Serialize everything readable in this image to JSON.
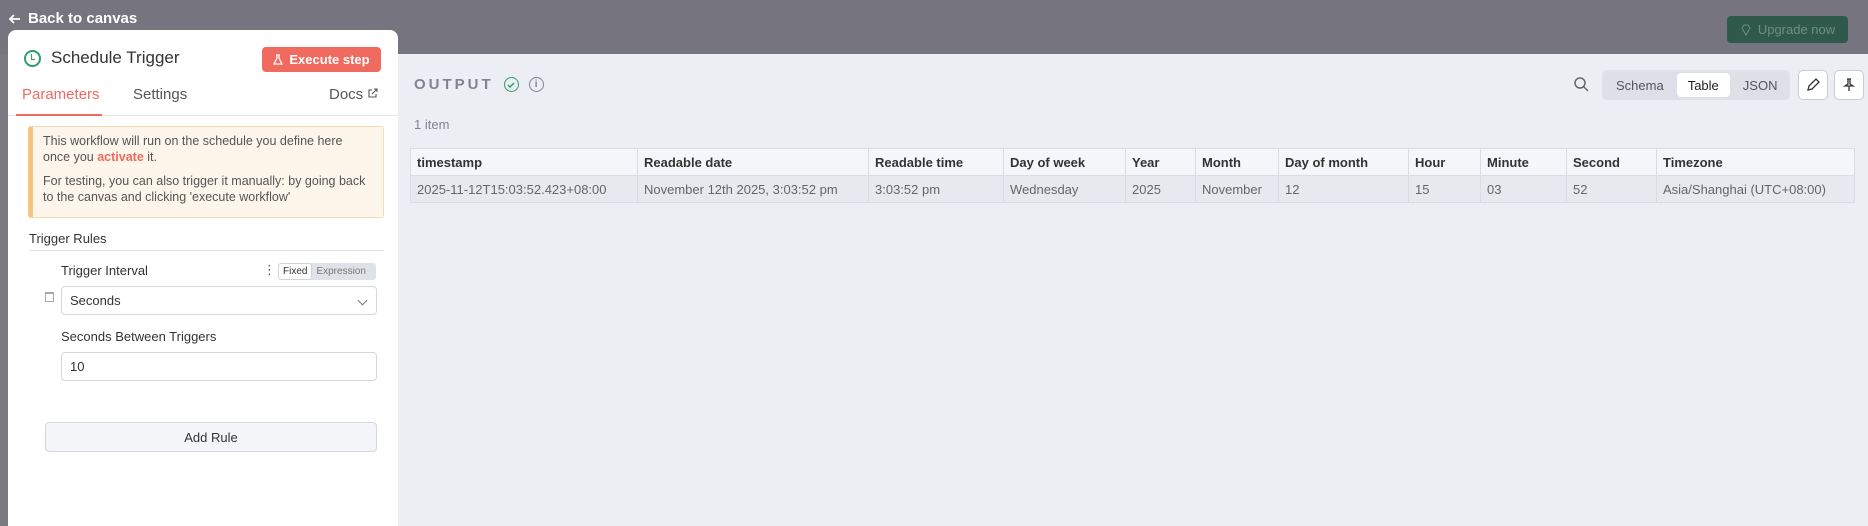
{
  "topbar": {
    "back_label": "Back to canvas",
    "upgrade_label": "Upgrade now"
  },
  "panel": {
    "title": "Schedule Trigger",
    "execute_label": "Execute step",
    "tabs": [
      "Parameters",
      "Settings"
    ],
    "docs_label": "Docs",
    "notice": {
      "line1": "This workflow will run on the schedule you define here once you",
      "activate_word": "activate",
      "line1_end": "it.",
      "line2": "For testing, you can also trigger it manually: by going back to the canvas and clicking 'execute workflow'"
    },
    "section_title": "Trigger Rules",
    "trigger_interval_label": "Trigger Interval",
    "mode_fixed": "Fixed",
    "mode_expression": "Expression",
    "interval_value": "Seconds",
    "seconds_label": "Seconds Between Triggers",
    "seconds_value": "10",
    "add_rule_label": "Add Rule"
  },
  "output": {
    "label": "OUTPUT",
    "views": [
      "Schema",
      "Table",
      "JSON"
    ],
    "active_view": "Table",
    "item_count": "1 item",
    "columns": [
      "timestamp",
      "Readable date",
      "Readable time",
      "Day of week",
      "Year",
      "Month",
      "Day of month",
      "Hour",
      "Minute",
      "Second",
      "Timezone"
    ],
    "rows": [
      [
        "2025-11-12T15:03:52.423+08:00",
        "November 12th 2025, 3:03:52 pm",
        "3:03:52 pm",
        "Wednesday",
        "2025",
        "November",
        "12",
        "15",
        "03",
        "52",
        "Asia/Shanghai (UTC+08:00)"
      ]
    ]
  },
  "colors": {
    "accent": "#f06a5f",
    "success": "#2e9e6a"
  }
}
